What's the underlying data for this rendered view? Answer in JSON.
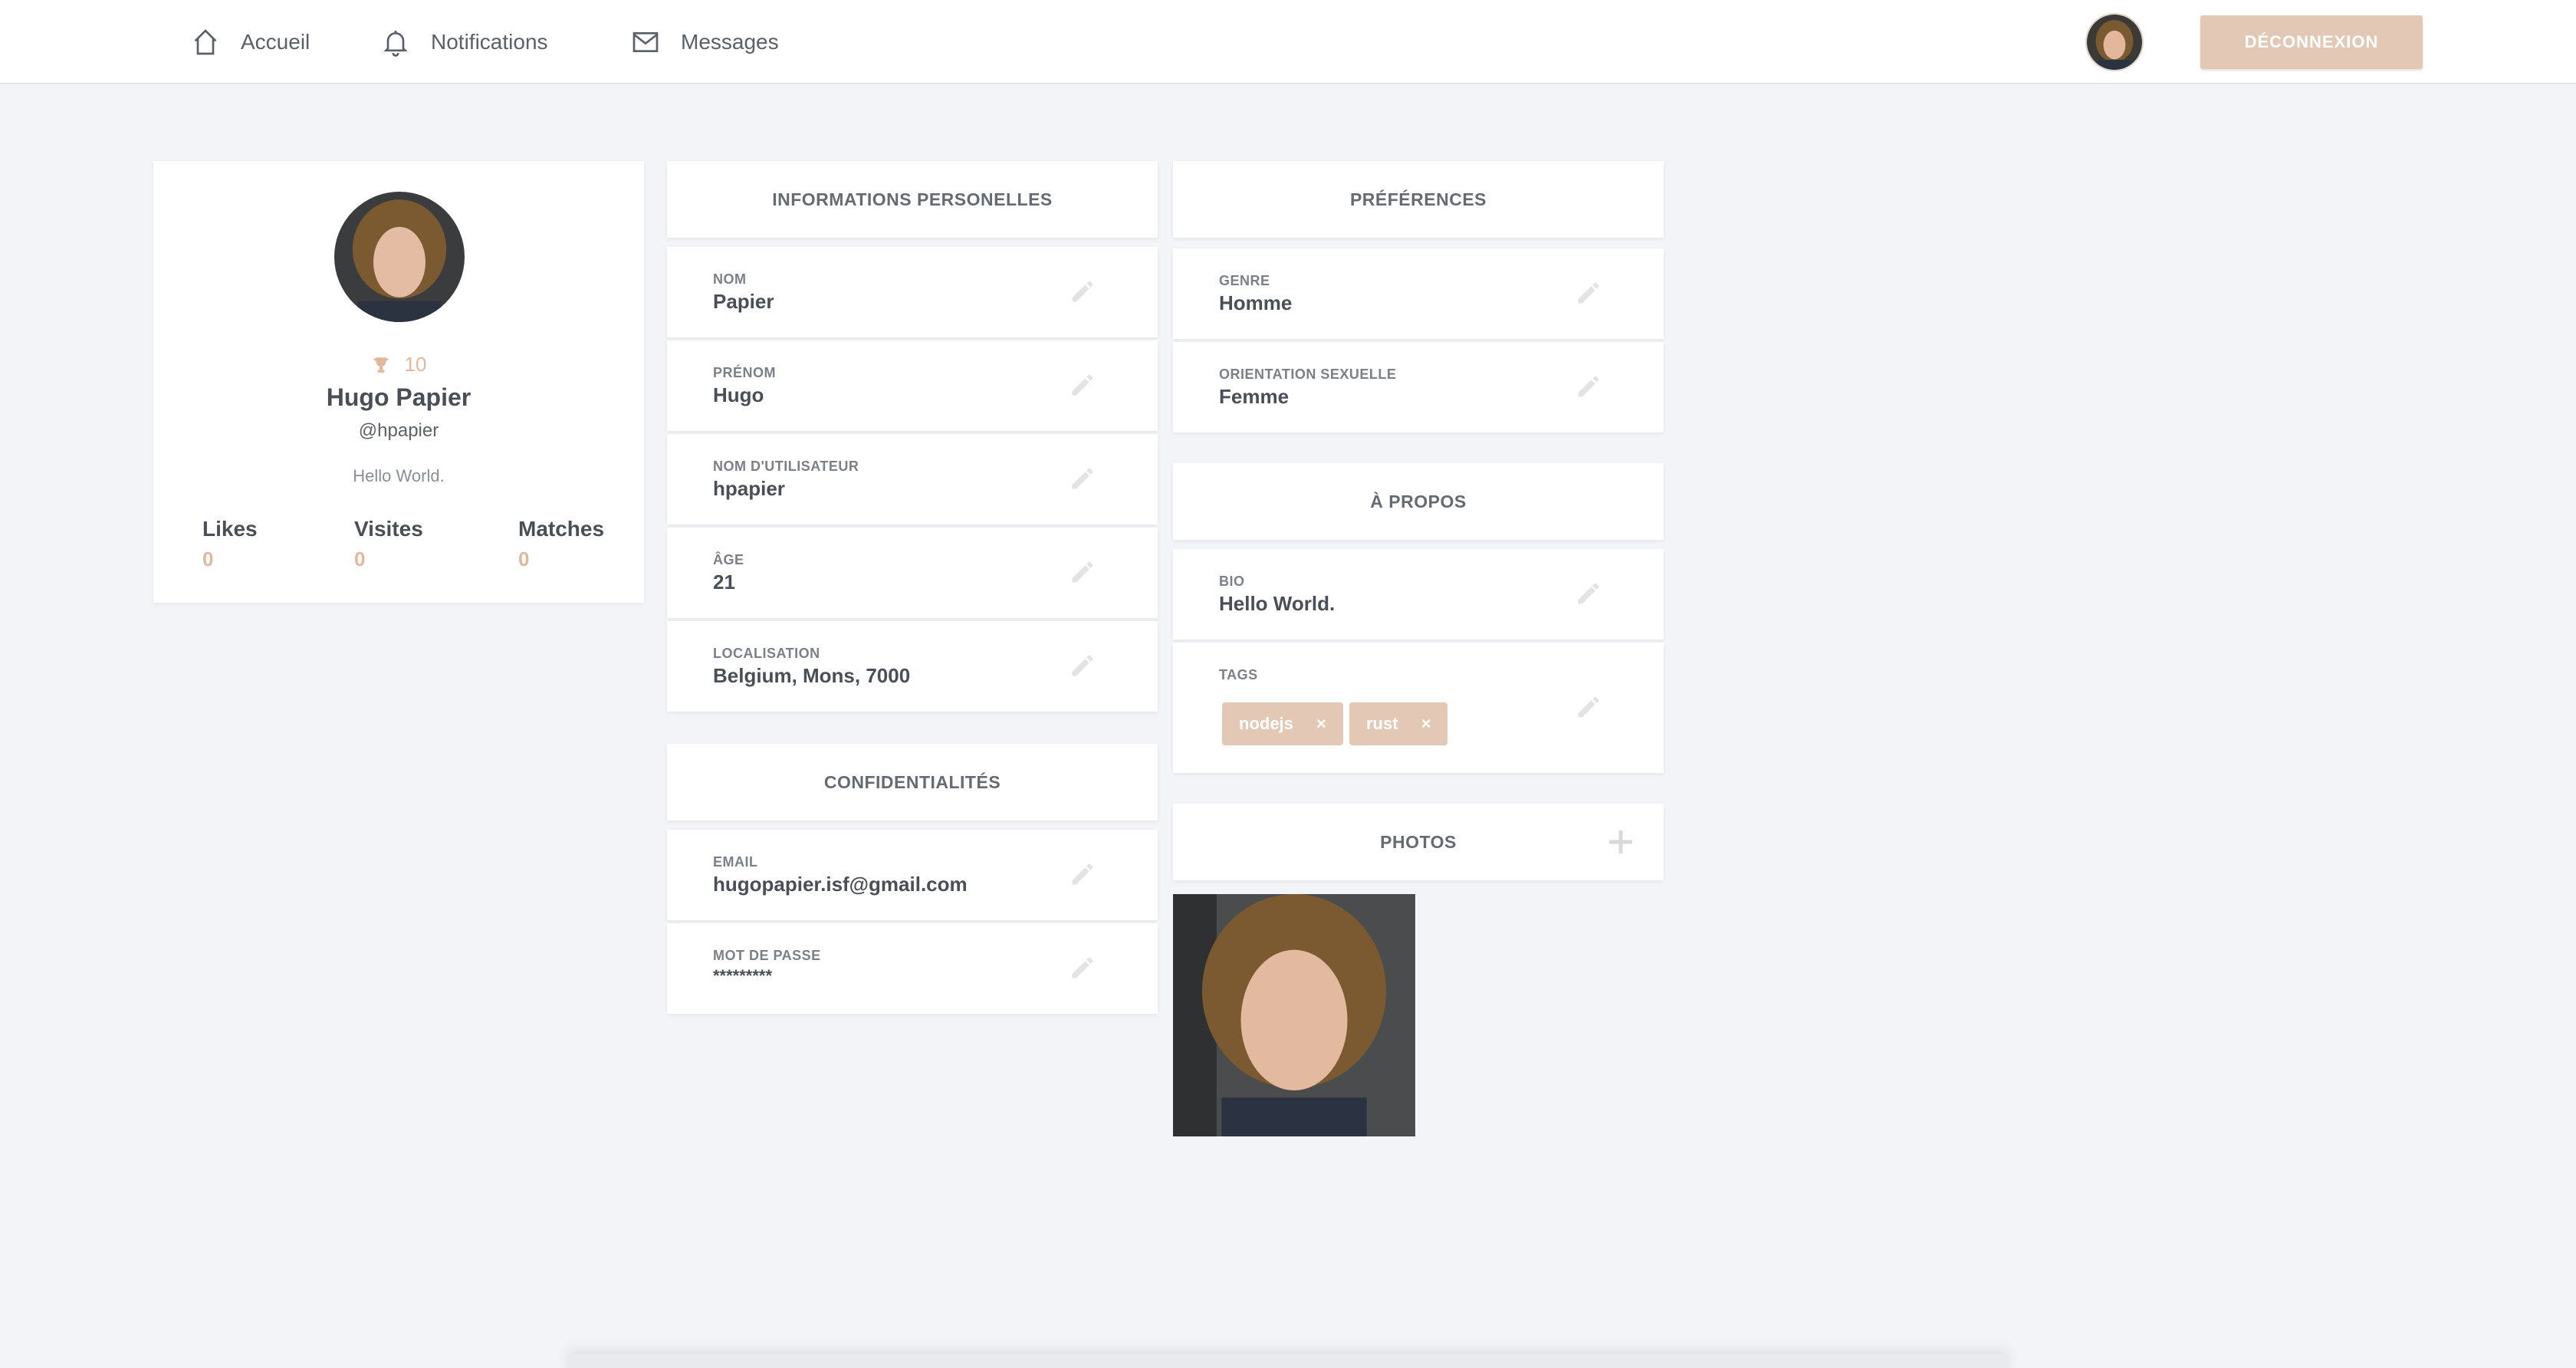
{
  "nav": {
    "home_label": "Accueil",
    "notifications_label": "Notifications",
    "messages_label": "Messages",
    "logout_label": "DÉCONNEXION"
  },
  "profile": {
    "score": "10",
    "full_name": "Hugo Papier",
    "handle": "@hpapier",
    "bio": "Hello World.",
    "stats": [
      {
        "label": "Likes",
        "value": "0"
      },
      {
        "label": "Visites",
        "value": "0"
      },
      {
        "label": "Matches",
        "value": "0"
      }
    ]
  },
  "personal": {
    "title": "INFORMATIONS PERSONELLES",
    "fields": [
      {
        "label": "NOM",
        "value": "Papier"
      },
      {
        "label": "PRÉNOM",
        "value": "Hugo"
      },
      {
        "label": "NOM D'UTILISATEUR",
        "value": "hpapier"
      },
      {
        "label": "ÂGE",
        "value": "21"
      },
      {
        "label": "LOCALISATION",
        "value": "Belgium, Mons, 7000"
      }
    ]
  },
  "privacy": {
    "title": "CONFIDENTIALITÉS",
    "fields": [
      {
        "label": "EMAIL",
        "value": "hugopapier.isf@gmail.com"
      },
      {
        "label": "MOT DE PASSE",
        "value": "*********"
      }
    ]
  },
  "preferences": {
    "title": "PRÉFÉRENCES",
    "fields": [
      {
        "label": "GENRE",
        "value": "Homme"
      },
      {
        "label": "ORIENTATION SEXUELLE",
        "value": "Femme"
      }
    ]
  },
  "about": {
    "title": "À PROPOS",
    "bio_label": "BIO",
    "bio_value": "Hello World.",
    "tags_label": "TAGS",
    "tags": [
      "nodejs",
      "rust"
    ],
    "tag_remove_symbol": "×"
  },
  "photos": {
    "title": "PHOTOS"
  },
  "colors": {
    "accent": "#e3c9b5",
    "accent_text": "#e3b79c",
    "background": "#f3f4f7"
  }
}
